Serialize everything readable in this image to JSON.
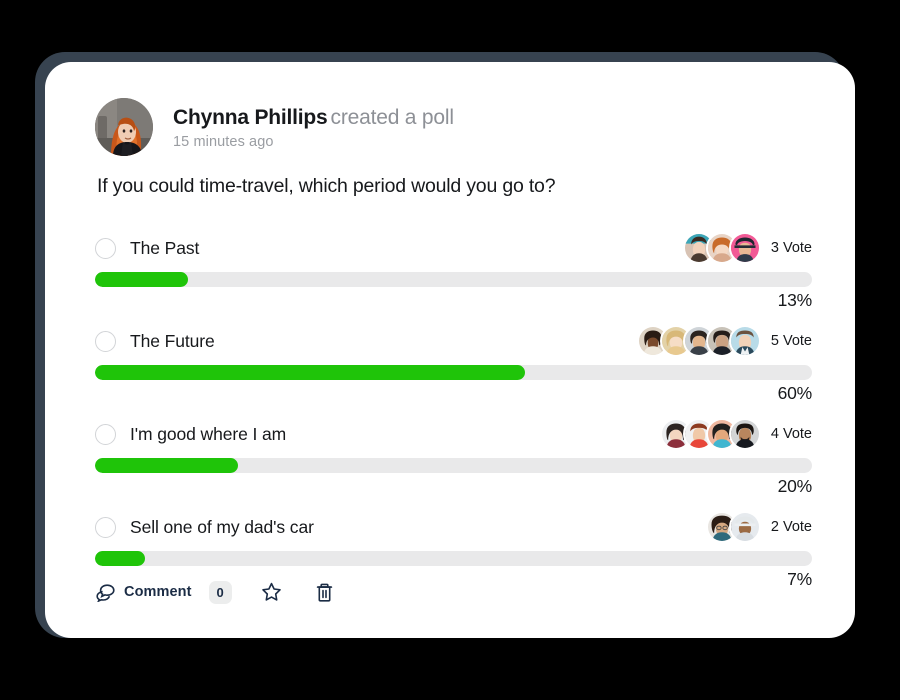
{
  "theme": {
    "page_background": "#000000",
    "backdrop_plate": "#374350",
    "card_background": "#ffffff",
    "accent_green": "#1fc409",
    "track_gray": "#e9e9ea",
    "text_dark": "#17191c",
    "text_muted": "#8d9096",
    "footer_navy": "#1b2c45",
    "badge_gray": "#eceded"
  },
  "post": {
    "author": "Chynna Phillips",
    "action": "created a poll",
    "timestamp": "15 minutes ago",
    "avatar_name": "chynna-phillips-avatar",
    "question": "If you could time-travel, which period would you go to?"
  },
  "poll": {
    "options": [
      {
        "label": "The Past",
        "votes_label": "3 Vote",
        "percent_label": "13%",
        "percent": 13,
        "voter_count": 3,
        "voters": [
          "voter-avatar-1",
          "voter-avatar-2",
          "voter-avatar-3"
        ]
      },
      {
        "label": "The Future",
        "votes_label": "5 Vote",
        "percent_label": "60%",
        "percent": 60,
        "voter_count": 5,
        "voters": [
          "voter-avatar-1",
          "voter-avatar-2",
          "voter-avatar-3",
          "voter-avatar-4",
          "voter-avatar-5"
        ]
      },
      {
        "label": "I'm good where I am",
        "votes_label": "4 Vote",
        "percent_label": "20%",
        "percent": 20,
        "voter_count": 4,
        "voters": [
          "voter-avatar-1",
          "voter-avatar-2",
          "voter-avatar-3",
          "voter-avatar-4"
        ]
      },
      {
        "label": "Sell one of my dad's car",
        "votes_label": "2 Vote",
        "percent_label": "7%",
        "percent": 7,
        "voter_count": 2,
        "voters": [
          "voter-avatar-1",
          "voter-avatar-2"
        ]
      }
    ]
  },
  "footer": {
    "comment_label": "Comment",
    "comment_count": "0",
    "comment_icon": "chat-bubbles-icon",
    "favorite_icon": "star-icon",
    "delete_icon": "trash-icon"
  }
}
